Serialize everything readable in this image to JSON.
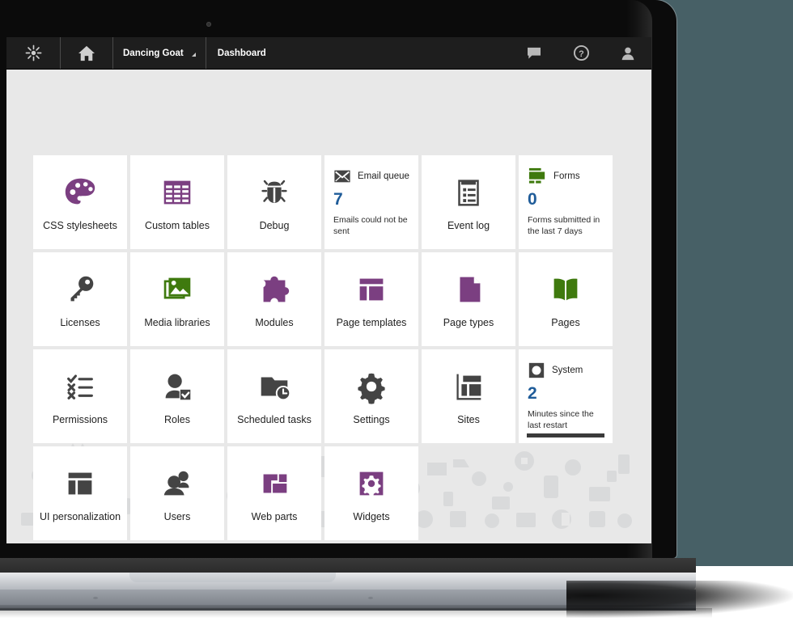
{
  "colors": {
    "purple": "#7b3f81",
    "green": "#3f7a0e",
    "dark": "#444444",
    "blue": "#1f5c99",
    "topbar": "#1e1e1e",
    "canvas": "#e8e8e8",
    "backdrop": "#476066"
  },
  "topbar": {
    "logo_icon": "kentico-logo-icon",
    "home_icon": "home-icon",
    "site_name": "Dancing Goat",
    "site_dropdown_icon": "chevron-down-icon",
    "section": "Dashboard",
    "right_icons": [
      {
        "name": "chat-icon",
        "label": "Messages"
      },
      {
        "name": "help-icon",
        "label": "Help"
      },
      {
        "name": "user-icon",
        "label": "Account"
      }
    ]
  },
  "tiles": [
    {
      "id": "css-stylesheets",
      "label": "CSS stylesheets",
      "icon": "palette-icon",
      "color": "purple",
      "type": "app"
    },
    {
      "id": "custom-tables",
      "label": "Custom tables",
      "icon": "table-icon",
      "color": "purple",
      "type": "app"
    },
    {
      "id": "debug",
      "label": "Debug",
      "icon": "bug-icon",
      "color": "dark",
      "type": "app"
    },
    {
      "id": "email-queue",
      "label": "Email queue",
      "icon": "envelope-icon",
      "color": "dark",
      "type": "info",
      "value": "7",
      "description": "Emails could not be sent"
    },
    {
      "id": "event-log",
      "label": "Event log",
      "icon": "clipboard-list-icon",
      "color": "dark",
      "type": "app"
    },
    {
      "id": "forms",
      "label": "Forms",
      "icon": "form-icon",
      "color": "green",
      "type": "info",
      "value": "0",
      "description": "Forms submitted in the last 7 days"
    },
    {
      "id": "licenses",
      "label": "Licenses",
      "icon": "key-icon",
      "color": "dark",
      "type": "app"
    },
    {
      "id": "media-libraries",
      "label": "Media libraries",
      "icon": "image-stack-icon",
      "color": "green",
      "type": "app"
    },
    {
      "id": "modules",
      "label": "Modules",
      "icon": "puzzle-icon",
      "color": "purple",
      "type": "app"
    },
    {
      "id": "page-templates",
      "label": "Page templates",
      "icon": "layout-icon",
      "color": "purple",
      "type": "app"
    },
    {
      "id": "page-types",
      "label": "Page types",
      "icon": "document-icon",
      "color": "purple",
      "type": "app"
    },
    {
      "id": "pages",
      "label": "Pages",
      "icon": "book-icon",
      "color": "green",
      "type": "app"
    },
    {
      "id": "permissions",
      "label": "Permissions",
      "icon": "checklist-icon",
      "color": "dark",
      "type": "app"
    },
    {
      "id": "roles",
      "label": "Roles",
      "icon": "user-check-icon",
      "color": "dark",
      "type": "app"
    },
    {
      "id": "scheduled-tasks",
      "label": "Scheduled tasks",
      "icon": "folder-clock-icon",
      "color": "dark",
      "type": "app"
    },
    {
      "id": "settings",
      "label": "Settings",
      "icon": "gear-icon",
      "color": "dark",
      "type": "app"
    },
    {
      "id": "sites",
      "label": "Sites",
      "icon": "sites-layout-icon",
      "color": "dark",
      "type": "app"
    },
    {
      "id": "system",
      "label": "System",
      "icon": "power-icon",
      "color": "dark",
      "type": "info",
      "value": "2",
      "description": "Minutes since the last restart",
      "has_bar": true
    },
    {
      "id": "ui-personalization",
      "label": "UI personalization",
      "icon": "layout-icon",
      "color": "dark",
      "type": "app"
    },
    {
      "id": "users",
      "label": "Users",
      "icon": "users-icon",
      "color": "dark",
      "type": "app"
    },
    {
      "id": "web-parts",
      "label": "Web parts",
      "icon": "webparts-icon",
      "color": "purple",
      "type": "app"
    },
    {
      "id": "widgets",
      "label": "Widgets",
      "icon": "widget-gear-icon",
      "color": "purple",
      "type": "app"
    }
  ]
}
